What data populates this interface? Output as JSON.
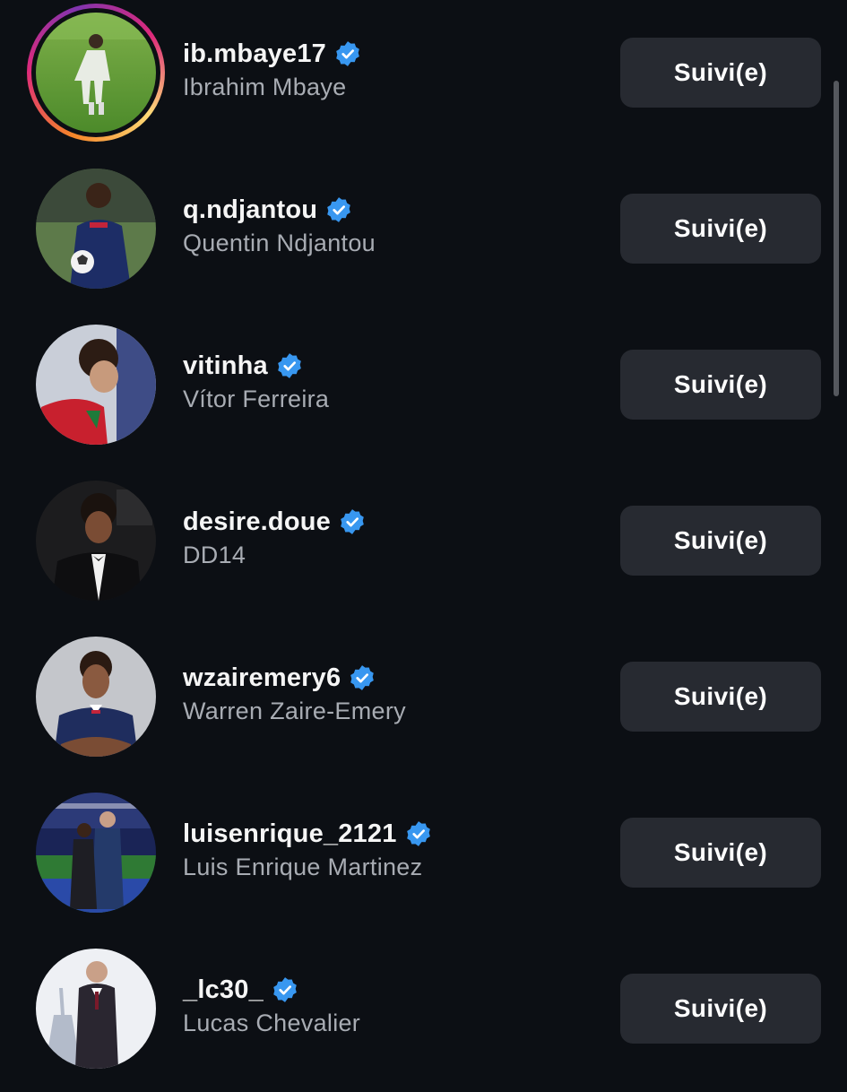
{
  "follow_label": "Suivi(e)",
  "colors": {
    "background": "#0c0f14",
    "button": "#272a31",
    "verified": "#3897f0",
    "secondary_text": "#a8acb3"
  },
  "accounts": [
    {
      "handle": "ib.mbaye17",
      "name": "Ibrahim Mbaye",
      "verified": true,
      "story_ring": true,
      "button_label": "Suivi(e)"
    },
    {
      "handle": "q.ndjantou",
      "name": "Quentin Ndjantou",
      "verified": true,
      "story_ring": false,
      "button_label": "Suivi(e)"
    },
    {
      "handle": "vitinha",
      "name": "Vítor Ferreira",
      "verified": true,
      "story_ring": false,
      "button_label": "Suivi(e)"
    },
    {
      "handle": "desire.doue",
      "name": "DD14",
      "verified": true,
      "story_ring": false,
      "button_label": "Suivi(e)"
    },
    {
      "handle": "wzairemery6",
      "name": "Warren Zaire-Emery",
      "verified": true,
      "story_ring": false,
      "button_label": "Suivi(e)"
    },
    {
      "handle": "luisenrique_2121",
      "name": "Luis Enrique Martinez",
      "verified": true,
      "story_ring": false,
      "button_label": "Suivi(e)"
    },
    {
      "handle": "_lc30_",
      "name": "Lucas Chevalier",
      "verified": true,
      "story_ring": false,
      "button_label": "Suivi(e)"
    }
  ]
}
